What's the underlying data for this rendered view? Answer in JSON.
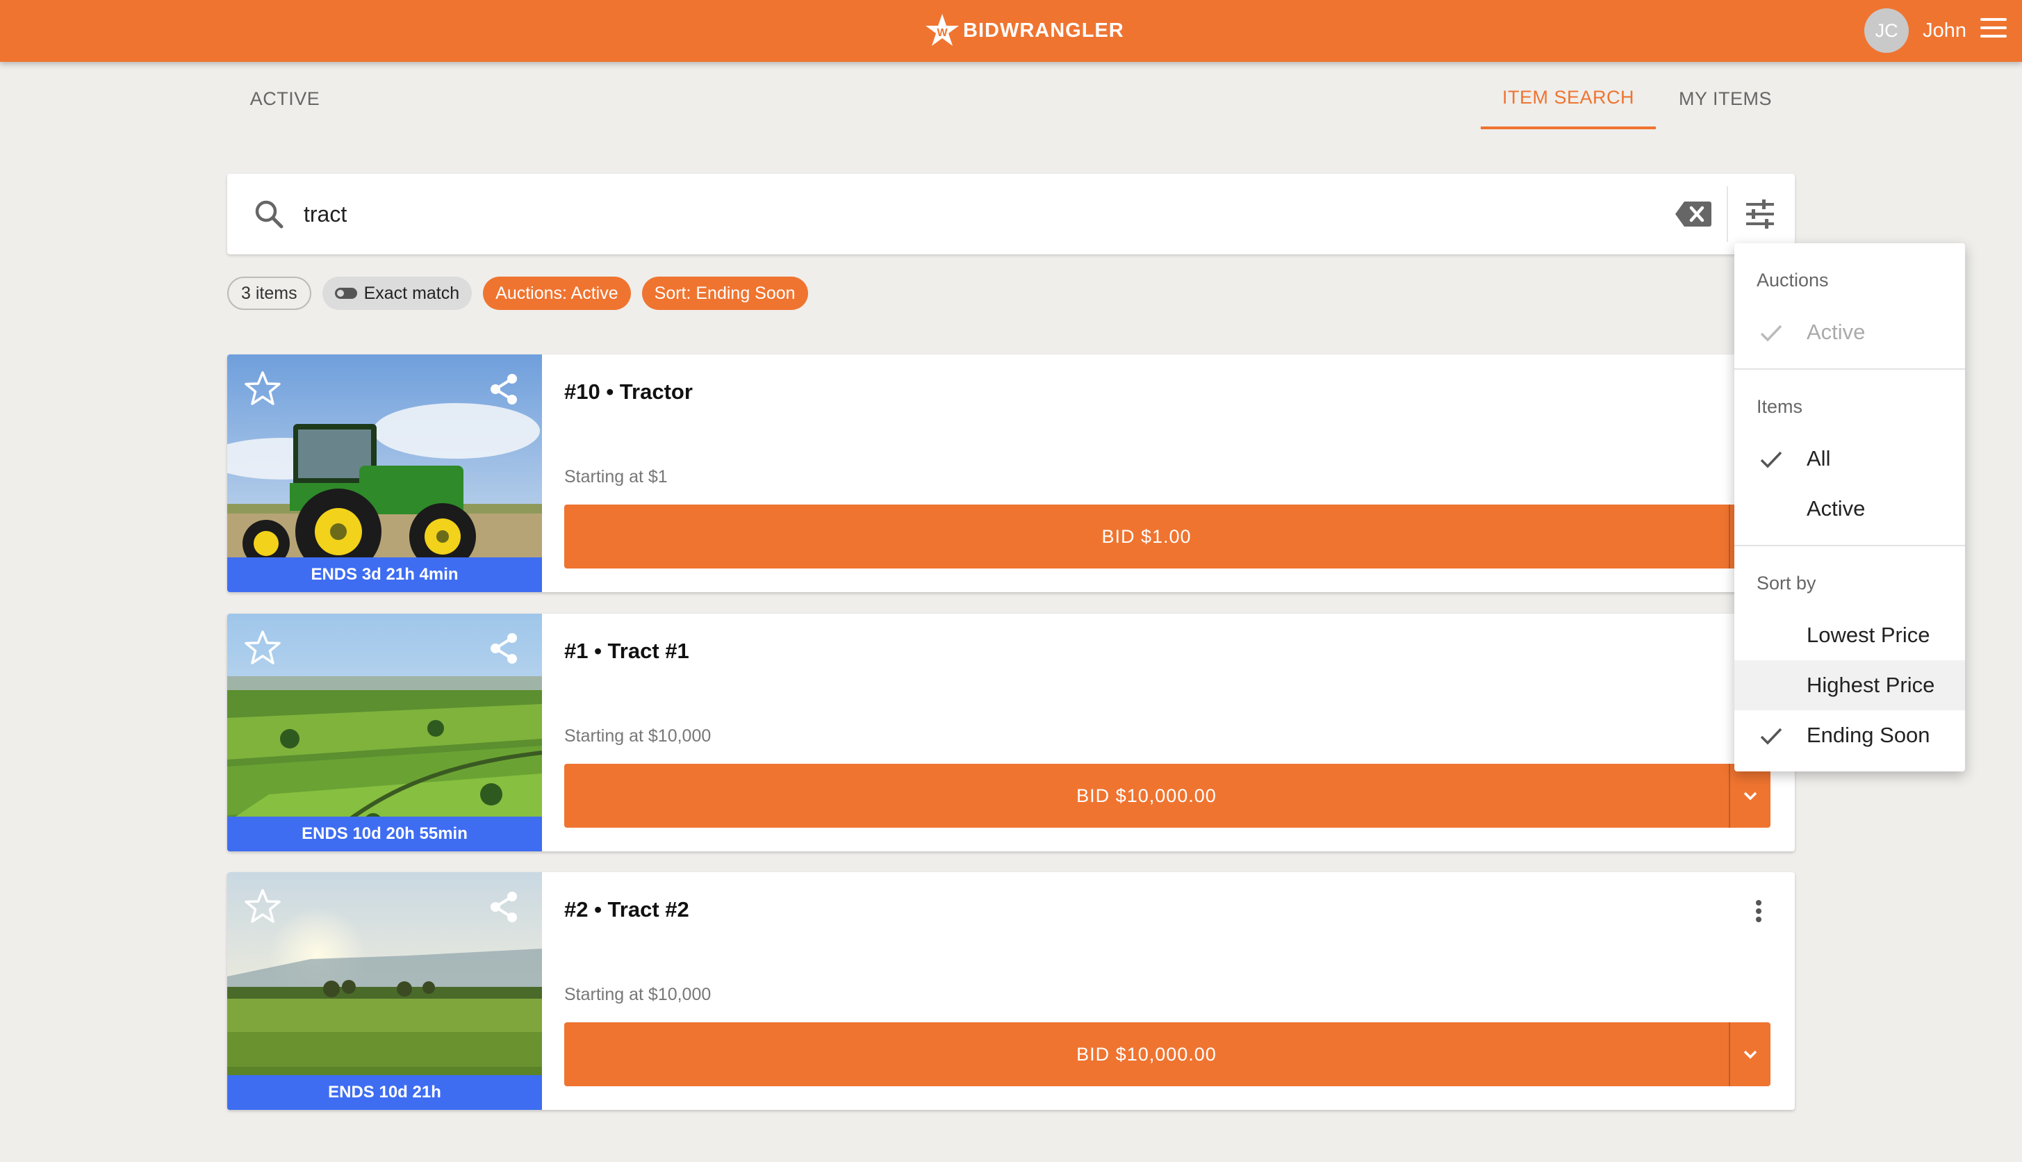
{
  "app": {
    "brand": "BIDWRANGLER",
    "user_initials": "JC",
    "user_name": "John"
  },
  "nav": {
    "left_tab": "ACTIVE",
    "tabs": [
      {
        "label": "ITEM SEARCH",
        "active": true
      },
      {
        "label": "MY ITEMS",
        "active": false
      }
    ]
  },
  "search": {
    "value": "tract",
    "placeholder": ""
  },
  "chips": {
    "count": "3 items",
    "exact_match": "Exact match",
    "auctions": "Auctions: Active",
    "sort": "Sort: Ending Soon"
  },
  "items": [
    {
      "title": "#10 • Tractor",
      "starting": "Starting at $1",
      "bid": "BID $1.00",
      "ends": "ENDS 3d 21h 4min"
    },
    {
      "title": "#1 • Tract #1",
      "starting": "Starting at $10,000",
      "bid": "BID $10,000.00",
      "ends": "ENDS 10d 20h 55min"
    },
    {
      "title": "#2 • Tract #2",
      "starting": "Starting at $10,000",
      "bid": "BID $10,000.00",
      "ends": "ENDS 10d 21h"
    }
  ],
  "filter_menu": {
    "auctions_heading": "Auctions",
    "auctions_active": "Active",
    "items_heading": "Items",
    "items_all": "All",
    "items_active": "Active",
    "sort_heading": "Sort by",
    "sort_lowest": "Lowest Price",
    "sort_highest": "Highest Price",
    "sort_ending": "Ending Soon"
  },
  "colors": {
    "brand_orange": "#ef7430",
    "ends_blue": "#3e6df2",
    "background": "#efeeeb"
  },
  "icons": [
    "logo-icon",
    "menu-icon",
    "search-icon",
    "clear-icon",
    "filter-icon",
    "star-icon",
    "share-icon",
    "chevron-down-icon",
    "more-vert-icon",
    "check-icon"
  ]
}
